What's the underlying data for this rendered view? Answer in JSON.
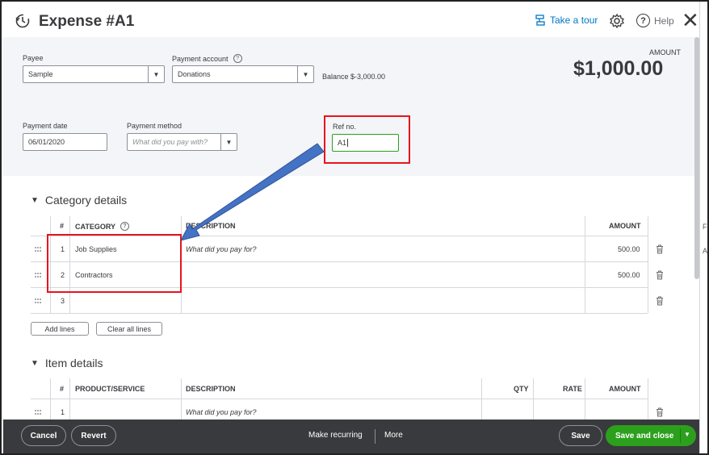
{
  "header": {
    "title": "Expense #A1",
    "take_tour": "Take a tour",
    "help": "Help"
  },
  "payee": {
    "label": "Payee",
    "value": "Sample"
  },
  "payment_account": {
    "label": "Payment account",
    "value": "Donations",
    "balance": "Balance $-3,000.00"
  },
  "amount": {
    "label": "AMOUNT",
    "value": "$1,000.00"
  },
  "payment_date": {
    "label": "Payment date",
    "value": "06/01/2020"
  },
  "payment_method": {
    "label": "Payment method",
    "placeholder": "What did you pay with?"
  },
  "ref_no": {
    "label": "Ref no.",
    "value": "A1"
  },
  "category_details": {
    "title": "Category details",
    "headers": {
      "num": "#",
      "category": "CATEGORY",
      "description": "DESCRIPTION",
      "amount": "AMOUNT"
    },
    "rows": [
      {
        "num": "1",
        "category": "Job Supplies",
        "description_placeholder": "What did you pay for?",
        "amount": "500.00"
      },
      {
        "num": "2",
        "category": "Contractors",
        "amount": "500.00"
      },
      {
        "num": "3"
      }
    ],
    "add_lines": "Add lines",
    "clear_all_lines": "Clear all lines"
  },
  "item_details": {
    "title": "Item details",
    "headers": {
      "num": "#",
      "product": "PRODUCT/SERVICE",
      "description": "DESCRIPTION",
      "qty": "QTY",
      "rate": "RATE",
      "amount": "AMOUNT"
    },
    "rows": [
      {
        "num": "1",
        "description_placeholder": "What did you pay for?"
      }
    ]
  },
  "footer": {
    "cancel": "Cancel",
    "revert": "Revert",
    "make_recurring": "Make recurring",
    "more": "More",
    "save": "Save",
    "save_and_close": "Save and close"
  },
  "side_strip": {
    "t1": "Fa",
    "t2": "A"
  },
  "colors": {
    "accent_green": "#2ca01c",
    "link_blue": "#0077c5",
    "annotation_red": "#e8141c",
    "annotation_arrow": "#4472c4"
  }
}
